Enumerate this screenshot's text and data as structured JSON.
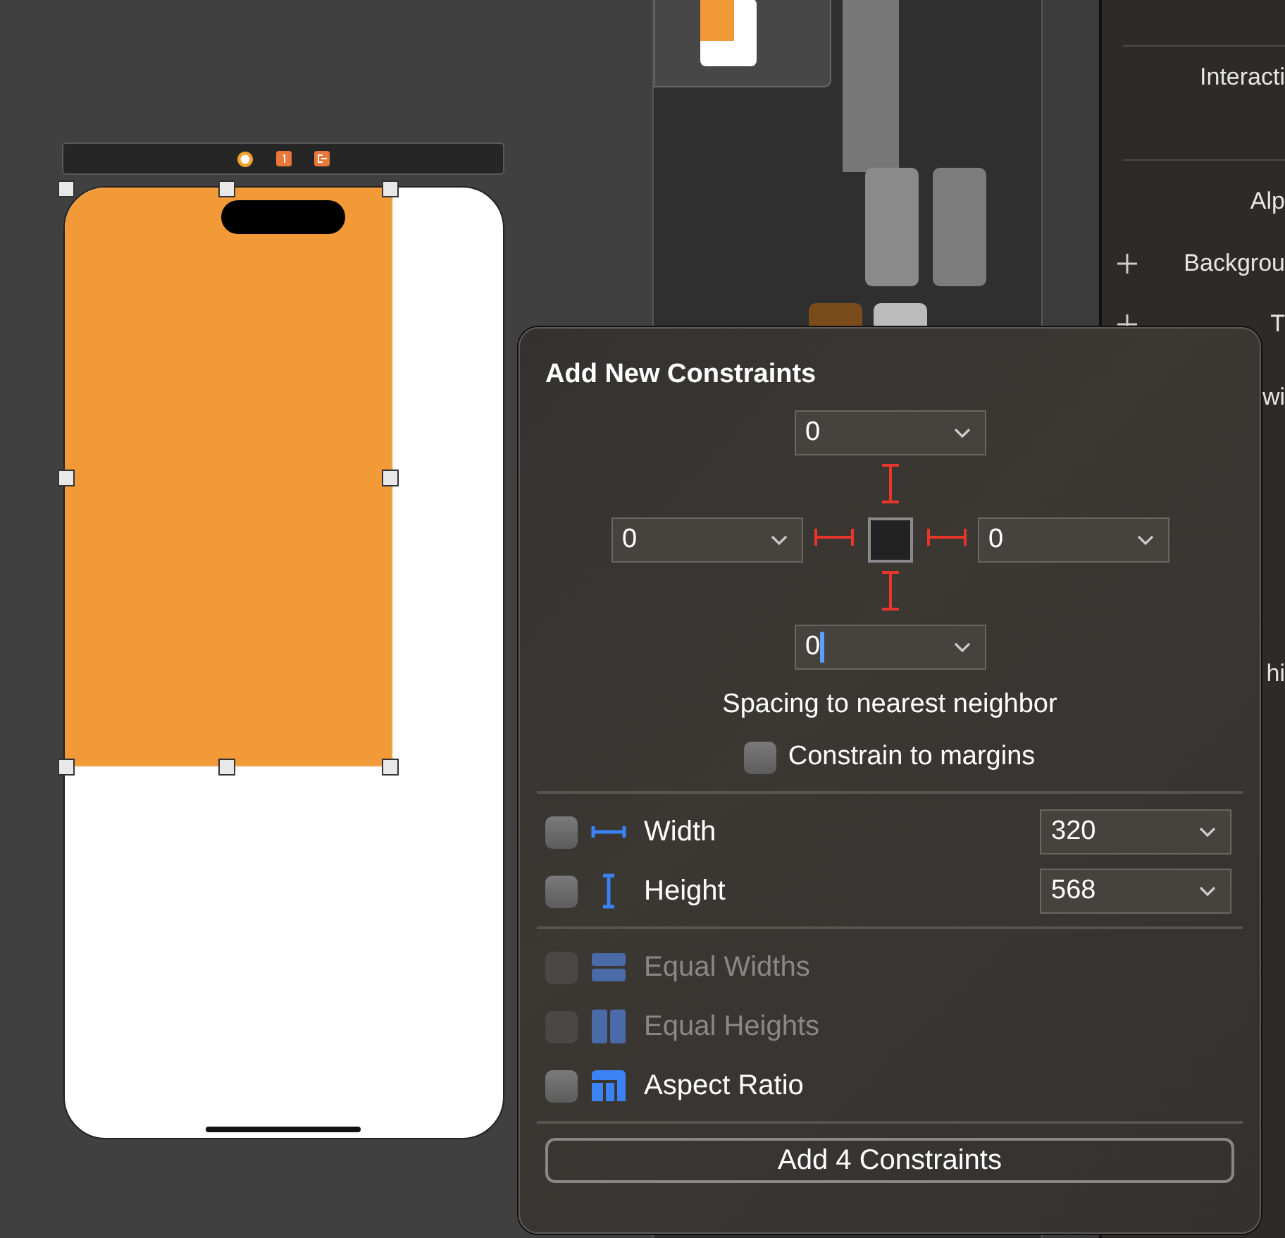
{
  "scene": {
    "bar_icons": [
      {
        "kind": "controller"
      },
      {
        "kind": "responder"
      },
      {
        "kind": "exit"
      }
    ],
    "view": {
      "selected": true
    }
  },
  "inspector": {
    "labels": [
      {
        "text": "Interacti",
        "plus": false
      },
      {
        "text": "Alp",
        "plus": false
      },
      {
        "text": "Backgrou",
        "plus": true
      },
      {
        "text": "T",
        "plus": true
      },
      {
        "text": "wi",
        "plus": false
      },
      {
        "text": "hi",
        "plus": false
      }
    ]
  },
  "popover": {
    "title": "Add New Constraints",
    "spacing_fields": [
      {
        "value": "0",
        "focused": false
      },
      {
        "value": "0",
        "focused": false
      },
      {
        "value": "0",
        "focused": false
      },
      {
        "value": "0",
        "focused": true
      }
    ],
    "spacing_caption": "Spacing to nearest neighbor",
    "constrain_to_margins": {
      "label": "Constrain to margins",
      "checked": false
    },
    "size_constraints": [
      {
        "kind": "width",
        "label": "Width",
        "value": "320",
        "checked": false
      },
      {
        "kind": "height",
        "label": "Height",
        "value": "568",
        "checked": false
      }
    ],
    "equal_constraints": [
      {
        "kind": "equal-widths",
        "label": "Equal Widths",
        "checked": false,
        "disabled": true
      },
      {
        "kind": "equal-heights",
        "label": "Equal Heights",
        "checked": false,
        "disabled": true
      },
      {
        "kind": "aspect-ratio",
        "label": "Aspect Ratio",
        "checked": false,
        "disabled": false
      }
    ],
    "button": "Add 4 Constraints"
  }
}
